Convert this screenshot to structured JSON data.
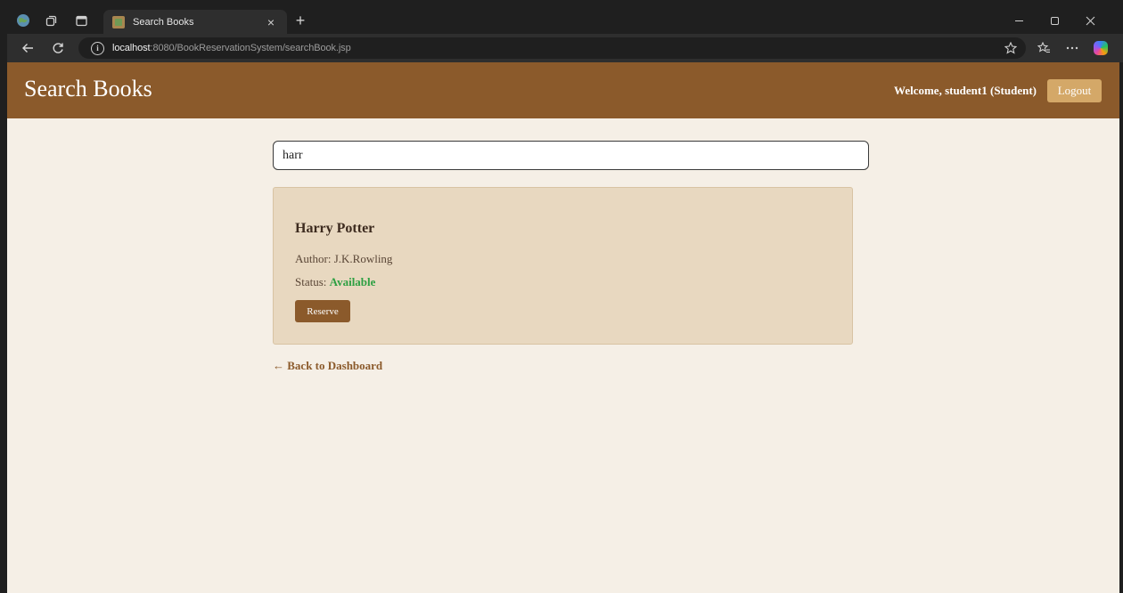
{
  "browser": {
    "tab_title": "Search Books",
    "tab_close": "×",
    "new_tab": "+",
    "url_host": "localhost",
    "url_rest": ":8080/BookReservationSystem/searchBook.jsp",
    "icons": [
      "globe-icon",
      "tab-actions-icon",
      "vertical-tabs-icon",
      "minimize-icon",
      "maximize-icon",
      "close-icon",
      "back-icon",
      "refresh-icon",
      "info-icon",
      "star-icon",
      "favorites-icon",
      "more-icon",
      "copilot-icon"
    ]
  },
  "header": {
    "title": "Search Books",
    "welcome": "Welcome, student1 (Student)",
    "logout_label": "Logout"
  },
  "search": {
    "value": "harr"
  },
  "results": [
    {
      "title": "Harry Potter",
      "author_prefix": "Author: ",
      "author": "J.K.Rowling",
      "status_prefix": "Status: ",
      "status": "Available",
      "reserve_label": "Reserve"
    }
  ],
  "back_link": "← Back to Dashboard",
  "colors": {
    "header_bg": "#8b5a2b",
    "page_bg": "#f5efe6",
    "card_bg": "#e8d8c0",
    "logout_bg": "#d4a868",
    "status_available": "#2ea043"
  }
}
